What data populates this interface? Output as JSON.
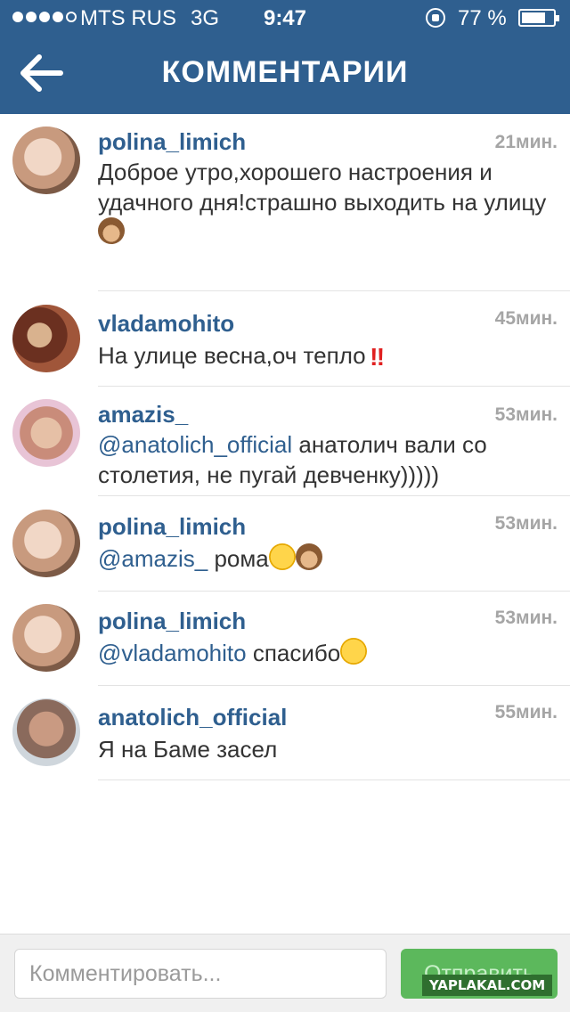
{
  "status_bar": {
    "carrier": "MTS RUS",
    "network": "3G",
    "time": "9:47",
    "battery_percent": "77 %",
    "battery_level": 0.77,
    "signal_bars_filled": 4,
    "signal_bars_total": 5
  },
  "nav": {
    "title": "КОММЕНТАРИИ",
    "back_icon": "back-arrow-icon"
  },
  "colors": {
    "header": "#2f5f8f",
    "username": "#2f5f8f",
    "send_button": "#5cb85c"
  },
  "comments": [
    {
      "username": "polina_limich",
      "time": "21мин.",
      "text": "Доброе утро,хорошего настроения и удачного дня!страшно выходить на улицу",
      "emoji": "see-no-evil-monkey"
    },
    {
      "username": "vladamohito",
      "time": "45мин.",
      "text": "На улице весна,оч тепло",
      "emoji": "double-exclamation"
    },
    {
      "username": "amazis_",
      "time": "53мин.",
      "mention": "@anatolich_official",
      "text": " анатолич вали со столетия, не пугай девченку)))))"
    },
    {
      "username": "polina_limich",
      "time": "53мин.",
      "mention": "@amazis_",
      "text": " рома",
      "emoji": "tears-of-joy, see-no-evil-monkey"
    },
    {
      "username": "polina_limich",
      "time": "53мин.",
      "mention": "@vladamohito",
      "text": " спасибо",
      "emoji": "winking-face"
    },
    {
      "username": "anatolich_official",
      "time": "55мин.",
      "text": "Я на Баме засел"
    }
  ],
  "composer": {
    "placeholder": "Комментировать...",
    "send_label": "Отправить"
  },
  "watermark": "YAPLAKAL.COM"
}
